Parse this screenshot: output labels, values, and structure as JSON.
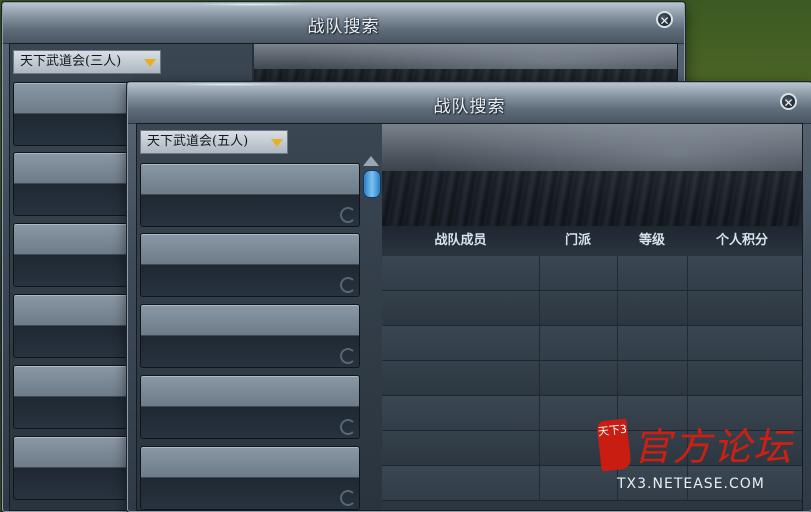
{
  "back_window": {
    "title": "战队搜索",
    "close_label": "✕",
    "dropdown_label": "天下武道会(三人)"
  },
  "front_window": {
    "title": "战队搜索",
    "close_label": "✕",
    "dropdown_label": "天下武道会(五人)",
    "table": {
      "columns": [
        "战队成员",
        "门派",
        "等级",
        "个人积分"
      ]
    }
  },
  "watermark": {
    "seal_text": "天下3",
    "text": "官方论坛",
    "url": "TX3.NETEASE.COM"
  },
  "colors": {
    "dropdown_arrow": "#e7b020",
    "scroll_thumb": "#4aa0e0",
    "watermark_red": "#d11e12"
  },
  "icons": {
    "close": "close-icon",
    "dropdown": "triangle-down-icon",
    "scroll_up": "scroll-up-icon"
  }
}
